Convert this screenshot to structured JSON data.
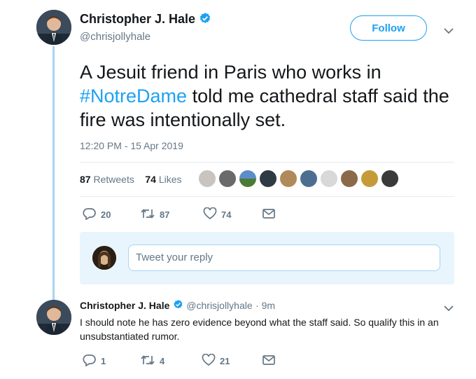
{
  "tweet": {
    "author_name": "Christopher J. Hale",
    "author_handle": "@chrisjollyhale",
    "follow_label": "Follow",
    "text_before": "A Jesuit friend in Paris who works in",
    "hashtag": "#NotreDame",
    "text_after": " told me cathedral staff said the fire was intentionally set.",
    "timestamp": "12:20 PM - 15 Apr 2019",
    "retweets_count": "87",
    "retweets_label": "Retweets",
    "likes_count": "74",
    "likes_label": "Likes",
    "actions": {
      "replies": "20",
      "retweets": "87",
      "likes": "74"
    }
  },
  "reply_composer": {
    "placeholder": "Tweet your reply"
  },
  "reply": {
    "author_name": "Christopher J. Hale",
    "author_handle": "@chrisjollyhale",
    "time": "· 9m",
    "text": "I should note he has zero evidence beyond what the staff said. So qualify this in an unsubstantiated rumor.",
    "actions": {
      "replies": "1",
      "retweets": "4",
      "likes": "21"
    }
  },
  "colors": {
    "accent": "#1da1f2",
    "muted": "#657786",
    "thread_line": "#a6d4f2",
    "composer_bg": "#e8f5fd"
  },
  "icons": [
    "verified-badge-icon",
    "chevron-down-icon",
    "reply-icon",
    "retweet-icon",
    "like-icon",
    "direct-message-icon"
  ]
}
